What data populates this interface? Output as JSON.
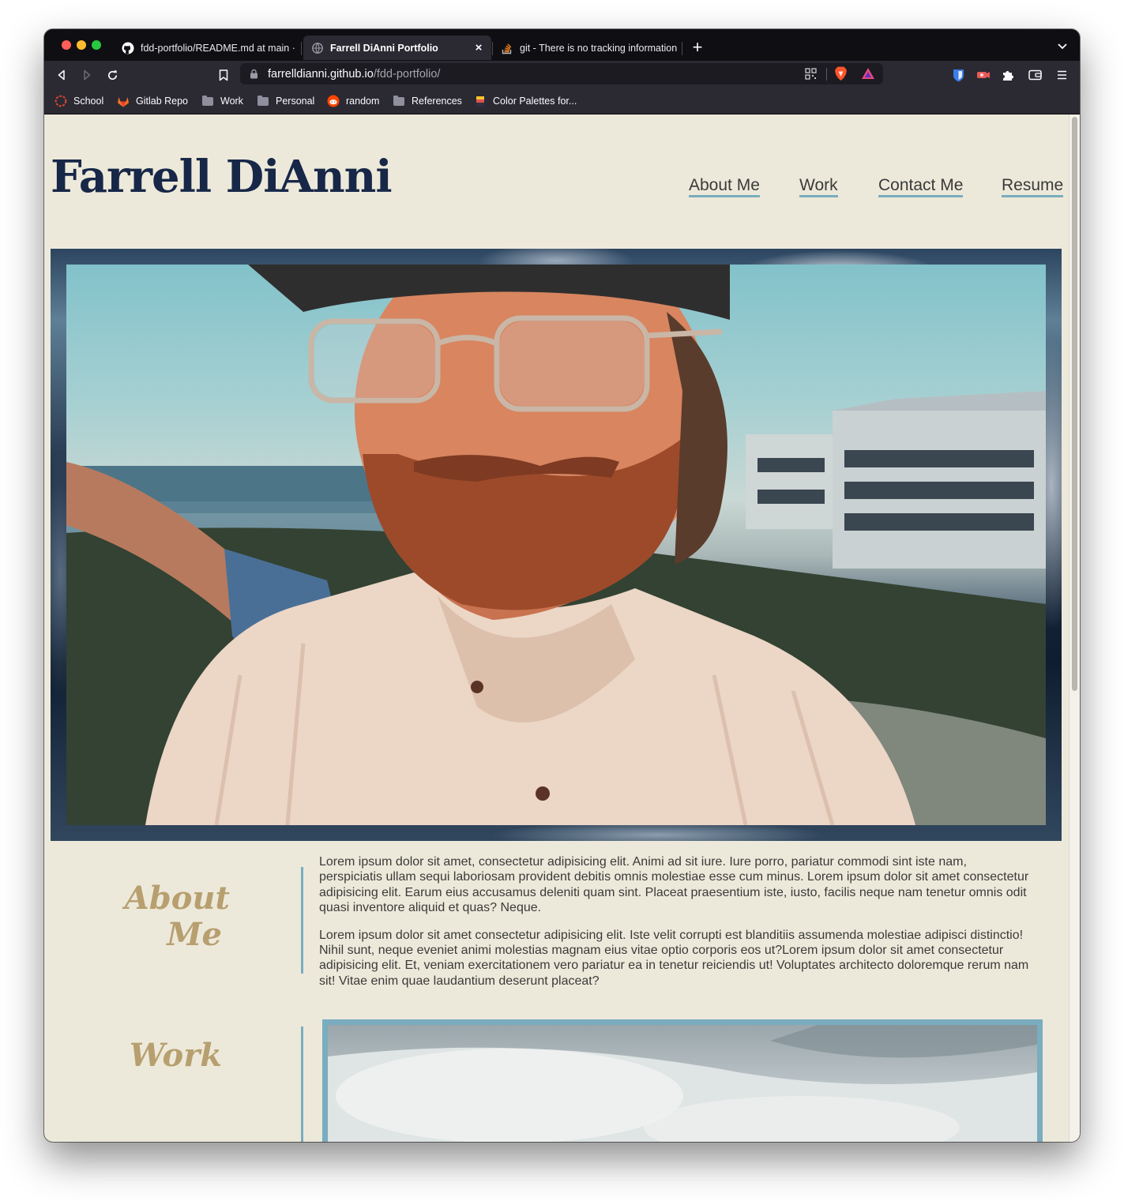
{
  "browser": {
    "tabs": [
      {
        "title": "fdd-portfolio/README.md at main ·",
        "favicon": "github-icon",
        "active": false
      },
      {
        "title": "Farrell DiAnni Portfolio",
        "favicon": "globe-icon",
        "active": true,
        "close": "×"
      },
      {
        "title": "git - There is no tracking information",
        "favicon": "stackoverflow-icon",
        "active": false
      }
    ],
    "new_tab": "+",
    "url": {
      "host": "farrelldianni.github.io",
      "path": "/fdd-portfolio/"
    },
    "bookmarks": [
      {
        "label": "School",
        "icon": "school-ring-icon"
      },
      {
        "label": "Gitlab Repo",
        "icon": "gitlab-icon"
      },
      {
        "label": "Work",
        "icon": "folder-icon"
      },
      {
        "label": "Personal",
        "icon": "folder-icon"
      },
      {
        "label": "random",
        "icon": "reddit-icon"
      },
      {
        "label": "References",
        "icon": "folder-icon"
      },
      {
        "label": "Color Palettes for...",
        "icon": "palette-icon"
      }
    ],
    "colors": {
      "chrome": "#2b2a33",
      "tabstrip": "#0f0f13",
      "accent_close": "#ff5f57"
    }
  },
  "site": {
    "title": "Farrell DiAnni",
    "nav": [
      "About Me",
      "Work",
      "Contact Me",
      "Resume"
    ],
    "colors": {
      "background": "#ede9da",
      "title": "#172748",
      "heading": "#b79f6f",
      "accent": "#79adbf",
      "text": "#3a3a3a"
    },
    "about": {
      "heading_line1": "About",
      "heading_line2": "Me",
      "paragraphs": [
        "Lorem ipsum dolor sit amet, consectetur adipisicing elit. Animi ad sit iure. Iure porro, pariatur commodi sint iste nam, perspiciatis ullam sequi laboriosam provident debitis omnis molestiae esse cum minus. Lorem ipsum dolor sit amet consectetur adipisicing elit. Earum eius accusamus deleniti quam sint. Placeat praesentium iste, iusto, facilis neque nam tenetur omnis odit quasi inventore aliquid et quas? Neque.",
        "Lorem ipsum dolor sit amet consectetur adipisicing elit. Iste velit corrupti est blanditiis assumenda molestiae adipisci distinctio! Nihil sunt, neque eveniet animi molestias magnam eius vitae optio corporis eos ut?Lorem ipsum dolor sit amet consectetur adipisicing elit. Et, veniam exercitationem vero pariatur ea in tenetur reiciendis ut! Voluptates architecto doloremque rerum nam sit! Vitae enim quae laudantium deserunt placeat?"
      ]
    },
    "work": {
      "heading": "Work"
    }
  }
}
